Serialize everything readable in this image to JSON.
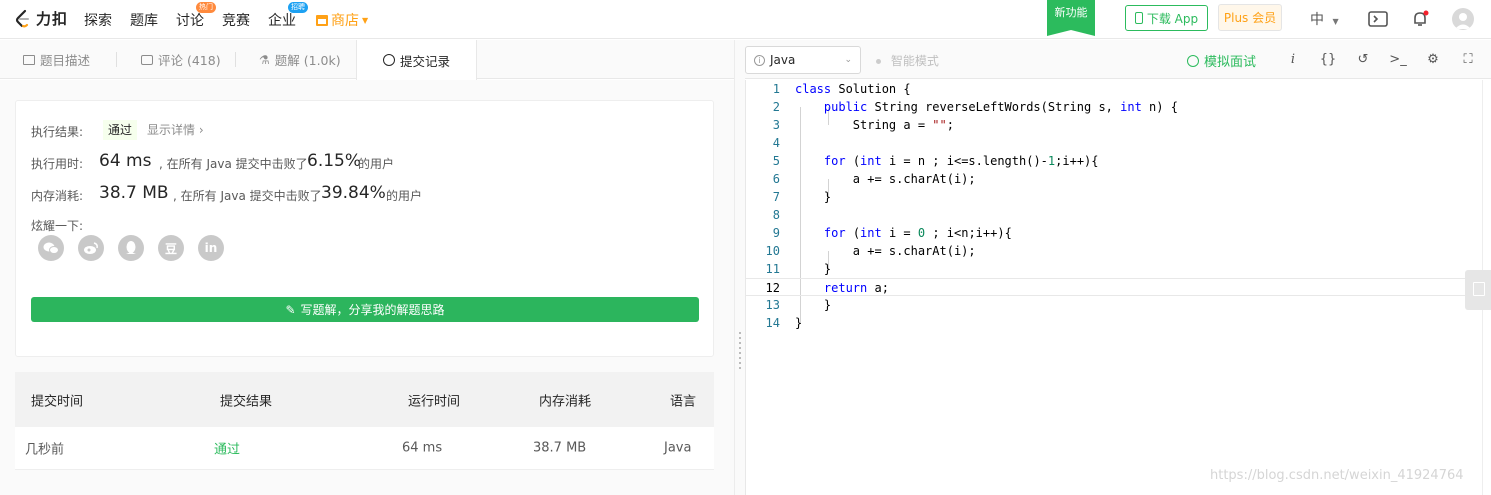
{
  "header": {
    "logo_text": "力扣",
    "nav": [
      {
        "label": "探索"
      },
      {
        "label": "题库"
      },
      {
        "label": "讨论",
        "badge": "热门"
      },
      {
        "label": "竞赛"
      },
      {
        "label": "企业",
        "badge": "招聘"
      },
      {
        "label": "商店"
      }
    ],
    "new_feature": "新功能",
    "download_label": "下载 App",
    "plus_label": "Plus 会员",
    "language": "中"
  },
  "tabs": [
    {
      "label": "题目描述",
      "icon": "description-icon"
    },
    {
      "label": "评论 (418)",
      "icon": "comment-icon"
    },
    {
      "label": "题解 (1.0k)",
      "icon": "flask-icon"
    },
    {
      "label": "提交记录",
      "icon": "clock-icon",
      "active": true
    }
  ],
  "result": {
    "status_label": "执行结果:",
    "status_value": "通过",
    "detail_link": "显示详情 ›",
    "time_label": "执行用时:",
    "time_value": "64 ms",
    "time_text": ", 在所有 Java 提交中击败了",
    "time_percent": "6.15%",
    "time_suffix": "的用户",
    "mem_label": "内存消耗:",
    "mem_value": "38.7 MB",
    "mem_text": ", 在所有 Java 提交中击败了",
    "mem_percent": "39.84%",
    "mem_suffix": "的用户",
    "share_label": "炫耀一下:",
    "share_icons": [
      "wechat-icon",
      "weibo-icon",
      "qq-icon",
      "douban-icon",
      "linkedin-icon"
    ],
    "douban_glyph": "豆",
    "linkedin_glyph": "in",
    "solution_button": "写题解，分享我的解题思路"
  },
  "submissions": {
    "headers": [
      "提交时间",
      "提交结果",
      "运行时间",
      "内存消耗",
      "语言"
    ],
    "rows": [
      {
        "time": "几秒前",
        "result": "通过",
        "runtime": "64 ms",
        "memory": "38.7 MB",
        "language": "Java"
      }
    ]
  },
  "editor": {
    "language": "Java",
    "smart_mode": "智能模式",
    "mock_interview": "模拟面试",
    "current_line": 12
  },
  "code_lines": [
    "class Solution {",
    "    public String reverseLeftWords(String s, int n) {",
    "        String a = \"\";",
    "",
    "    for (int i = n ; i<=s.length()-1;i++){",
    "        a += s.charAt(i);",
    "    }",
    "",
    "    for (int i = 0 ; i<n;i++){",
    "        a += s.charAt(i);",
    "    }",
    "    return a;",
    "    }",
    "}"
  ],
  "watermark": "https://blog.csdn.net/weixin_41924764",
  "colors": {
    "accent_green": "#2cbb5d",
    "accent_orange": "#ffa116"
  }
}
